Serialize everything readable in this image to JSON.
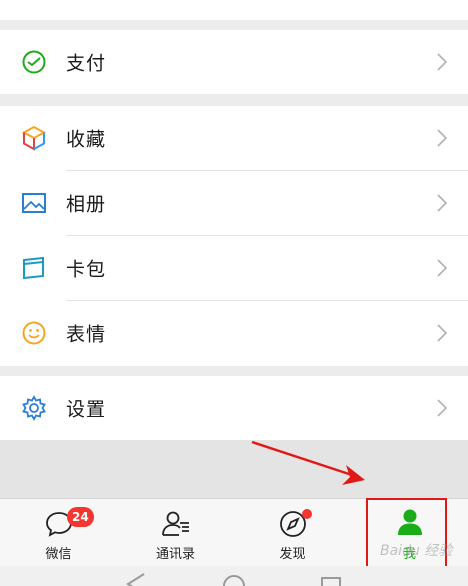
{
  "menu": {
    "pay": {
      "label": "支付",
      "icon": "pay-icon"
    },
    "favorites": {
      "label": "收藏",
      "icon": "favorites-cube-icon"
    },
    "album": {
      "label": "相册",
      "icon": "album-image-icon"
    },
    "cards": {
      "label": "卡包",
      "icon": "card-wallet-icon"
    },
    "stickers": {
      "label": "表情",
      "icon": "smiley-icon"
    },
    "settings": {
      "label": "设置",
      "icon": "gear-icon"
    }
  },
  "tabbar": {
    "tabs": [
      {
        "label": "微信",
        "icon": "chat-bubble-icon",
        "badge": "24"
      },
      {
        "label": "通讯录",
        "icon": "contacts-icon"
      },
      {
        "label": "发现",
        "icon": "compass-icon"
      },
      {
        "label": "我",
        "icon": "me-person-icon",
        "active": true
      }
    ]
  },
  "watermark": "Baidu 经验",
  "colors": {
    "accent_green": "#1aad19",
    "badge_red": "#f43530",
    "highlight_red": "#e01818",
    "favorites_colors": [
      "#f5a623",
      "#e64340",
      "#2a9ef4",
      "#1aad19"
    ],
    "album_blue": "#2a7fd4",
    "card_teal": "#1b9bc4",
    "smiley_orange": "#f5a623",
    "settings_blue": "#2a7fd4"
  }
}
